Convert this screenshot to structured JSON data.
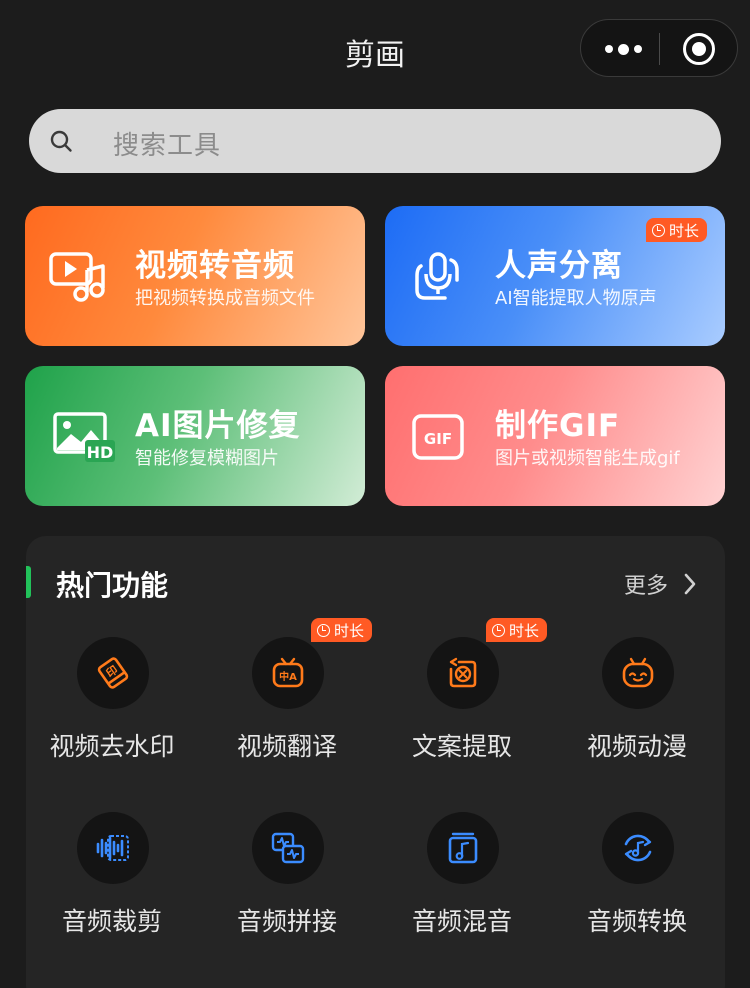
{
  "nav": {
    "title": "剪画"
  },
  "search": {
    "placeholder": "搜索工具"
  },
  "cards": [
    {
      "title": "视频转音频",
      "desc": "把视频转换成音频文件",
      "icon": "video-to-audio-icon"
    },
    {
      "title": "人声分离",
      "desc": "AI智能提取人物原声",
      "icon": "microphone-icon",
      "badge": "时长"
    },
    {
      "title": "AI图片修复",
      "desc": "智能修复模糊图片",
      "icon": "hd-image-icon"
    },
    {
      "title": "制作GIF",
      "desc": "图片或视频智能生成gif",
      "icon": "gif-icon"
    }
  ],
  "hot": {
    "title": "热门功能",
    "more": "更多",
    "tools": [
      {
        "label": "视频去水印",
        "icon": "stamp-eraser-icon"
      },
      {
        "label": "视频翻译",
        "icon": "translate-tv-icon",
        "badge": "时长"
      },
      {
        "label": "文案提取",
        "icon": "text-extract-icon",
        "badge": "时长"
      },
      {
        "label": "视频动漫",
        "icon": "anime-face-icon"
      },
      {
        "label": "音频裁剪",
        "icon": "waveform-crop-icon"
      },
      {
        "label": "音频拼接",
        "icon": "audio-merge-icon"
      },
      {
        "label": "音频混音",
        "icon": "music-mix-icon"
      },
      {
        "label": "音频转换",
        "icon": "audio-convert-icon"
      }
    ]
  },
  "colors": {
    "accent_orange": "#ff6a1f",
    "accent_green": "#22c25a",
    "background": "#1c1c1c",
    "badge": "#ff5a24",
    "tool_icon_orange": "#ff7a1a",
    "tool_icon_blue": "#3b8cff"
  }
}
